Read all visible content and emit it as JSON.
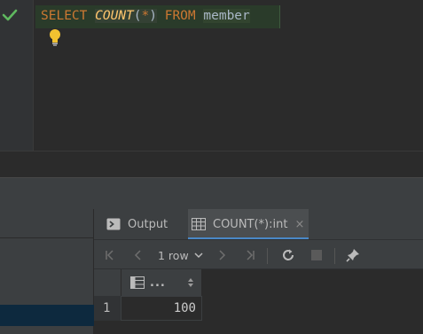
{
  "editor": {
    "query": {
      "select": "SELECT",
      "count_fn": "COUNT",
      "open_paren": "(",
      "star": "*",
      "close_paren": ")",
      "from": "FROM",
      "table": "member"
    }
  },
  "results": {
    "tabs": [
      {
        "label": "Output",
        "icon": "console-icon"
      },
      {
        "label": "COUNT(*):int",
        "icon": "table-icon",
        "close": "×"
      }
    ],
    "toolbar": {
      "rows_label": "1 row",
      "icons": [
        "first-page-icon",
        "prev-page-icon",
        "next-page-icon",
        "last-page-icon",
        "refresh-icon",
        "stop-icon",
        "pin-icon"
      ]
    },
    "grid": {
      "column_header": "...",
      "rows": [
        {
          "num": "1",
          "value": "100"
        }
      ]
    }
  },
  "colors": {
    "keyword": "#cc7832",
    "function": "#ffc66d",
    "identifier": "#a9b7c6",
    "check": "#5fb85f",
    "selection": "#0d293e",
    "tab_underline": "#4a88c7"
  }
}
